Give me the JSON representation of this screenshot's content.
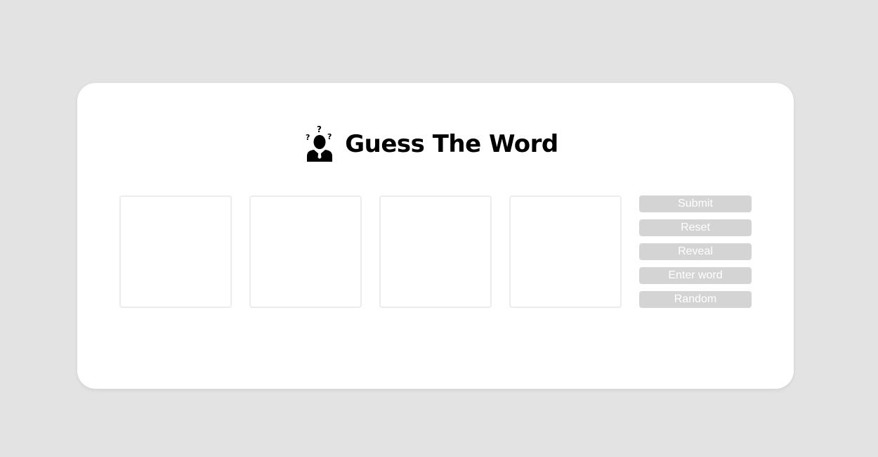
{
  "header": {
    "title": "Guess The Word",
    "logo_icon": "confused-person-icon"
  },
  "letter_boxes": [
    "",
    "",
    "",
    ""
  ],
  "buttons": {
    "submit": "Submit",
    "reset": "Reset",
    "reveal": "Reveal",
    "enter_word": "Enter word",
    "random": "Random"
  },
  "colors": {
    "page_background": "#e3e3e3",
    "card_background": "#ffffff",
    "button_background": "#d4d4d4",
    "button_text": "#ffffff",
    "box_border": "#ececec"
  }
}
